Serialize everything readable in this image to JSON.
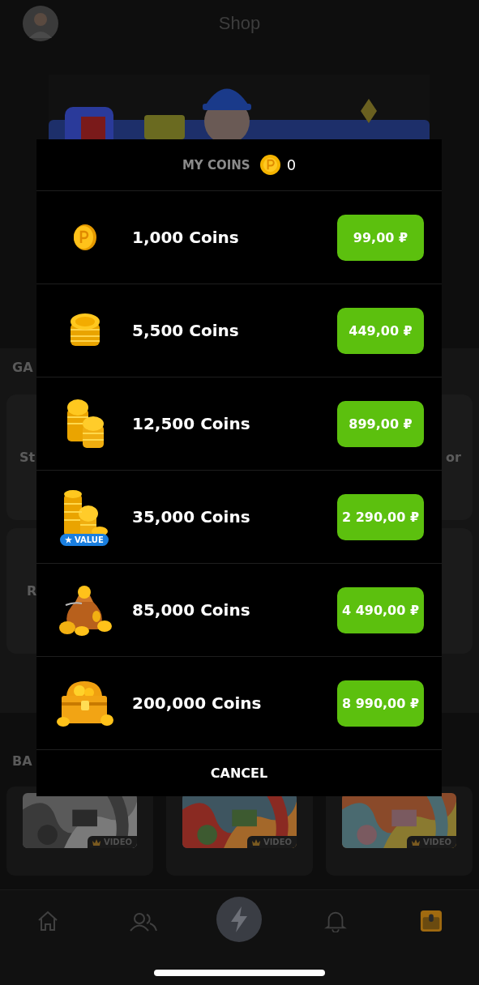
{
  "header": {
    "title": "Shop"
  },
  "games": {
    "heading": "GA",
    "card_rows": [
      {
        "left_label": "St",
        "right_label": "or"
      },
      {
        "left_label": "R"
      }
    ]
  },
  "banners": {
    "heading": "BA",
    "videos": [
      {
        "badge": "VIDEO"
      },
      {
        "badge": "VIDEO"
      },
      {
        "badge": "VIDEO"
      }
    ]
  },
  "modal": {
    "title": "MY COINS",
    "balance": "0",
    "cancel": "CANCEL",
    "packs": [
      {
        "kind": "coin",
        "amount": "1,000 Coins",
        "price": "99,00 ₽"
      },
      {
        "kind": "stack",
        "amount": "5,500 Coins",
        "price": "449,00 ₽"
      },
      {
        "kind": "stacks",
        "amount": "12,500 Coins",
        "price": "899,00 ₽"
      },
      {
        "kind": "tower",
        "amount": "35,000 Coins",
        "price": "2 290,00 ₽",
        "badge": "VALUE"
      },
      {
        "kind": "bag",
        "amount": "85,000 Coins",
        "price": "4 490,00 ₽"
      },
      {
        "kind": "chest",
        "amount": "200,000 Coins",
        "price": "8 990,00 ₽"
      }
    ]
  },
  "nav": [
    {
      "kind": "home",
      "selected": false
    },
    {
      "kind": "friends",
      "selected": false
    },
    {
      "kind": "bolt",
      "selected": false
    },
    {
      "kind": "bell",
      "selected": false
    },
    {
      "kind": "chest",
      "selected": true
    }
  ]
}
